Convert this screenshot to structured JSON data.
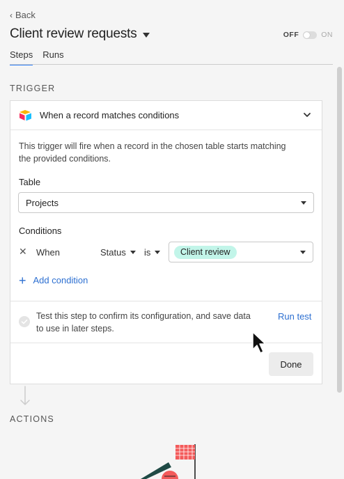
{
  "header": {
    "back_label": "Back",
    "title": "Client review requests",
    "toggle": {
      "off_label": "OFF",
      "on_label": "ON",
      "state": "off"
    }
  },
  "tabs": [
    {
      "label": "Steps",
      "active": true
    },
    {
      "label": "Runs",
      "active": false
    }
  ],
  "trigger": {
    "section_label": "TRIGGER",
    "card_title": "When a record matches conditions",
    "description": "This trigger will fire when a record in the chosen table starts matching the provided conditions.",
    "table_label": "Table",
    "table_value": "Projects",
    "conditions_label": "Conditions",
    "condition": {
      "prefix": "When",
      "field": "Status",
      "operator": "is",
      "value": "Client review"
    },
    "add_condition_label": "Add condition",
    "test_text": "Test this step to confirm its configuration, and save data to use in later steps.",
    "run_test_label": "Run test",
    "done_label": "Done"
  },
  "actions": {
    "section_label": "ACTIONS"
  },
  "colors": {
    "accent_blue": "#2c6fd1",
    "tab_underline": "#2d7ff9",
    "pill_bg": "#c2f5e9"
  }
}
